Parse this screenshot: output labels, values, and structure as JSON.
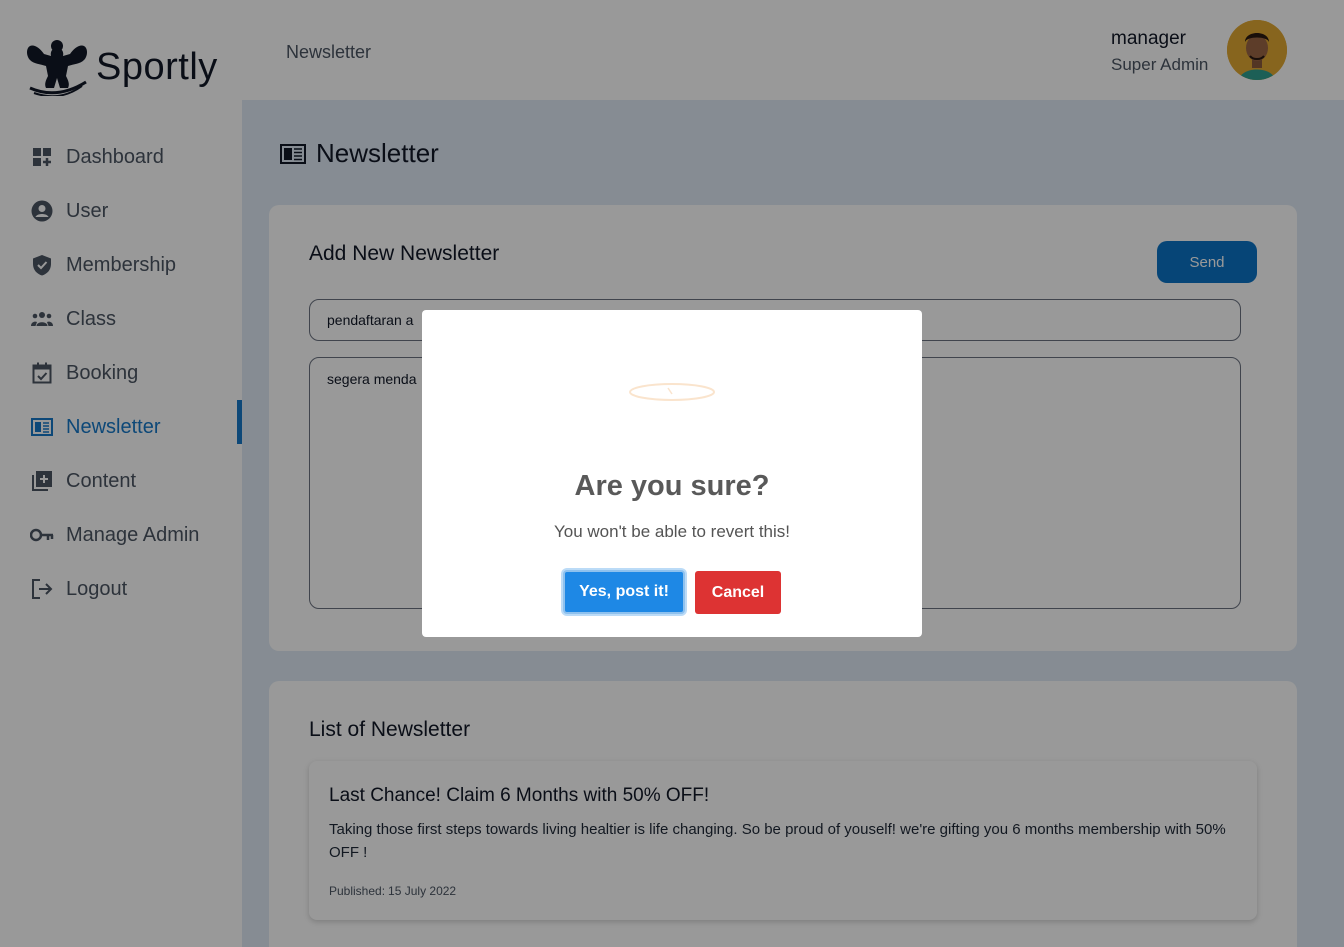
{
  "app": {
    "brand_name": "Sportly"
  },
  "sidebar": {
    "items": [
      {
        "label": "Dashboard",
        "icon": "dashboard-icon"
      },
      {
        "label": "User",
        "icon": "user-icon"
      },
      {
        "label": "Membership",
        "icon": "shield-icon"
      },
      {
        "label": "Class",
        "icon": "group-icon"
      },
      {
        "label": "Booking",
        "icon": "calendar-check-icon"
      },
      {
        "label": "Newsletter",
        "icon": "newspaper-icon",
        "active": true
      },
      {
        "label": "Content",
        "icon": "library-add-icon"
      },
      {
        "label": "Manage Admin",
        "icon": "key-icon"
      },
      {
        "label": "Logout",
        "icon": "logout-icon"
      }
    ]
  },
  "header": {
    "title": "Newsletter",
    "user": {
      "name": "manager",
      "role": "Super Admin"
    }
  },
  "main": {
    "page_title": "Newsletter",
    "add_form": {
      "title": "Add New Newsletter",
      "send_label": "Send",
      "title_value": "pendaftaran a",
      "body_value": "segera menda"
    },
    "list": {
      "title": "List of Newsletter",
      "items": [
        {
          "title": "Last Chance! Claim 6 Months with 50% OFF!",
          "body": "Taking those first steps towards living healtier is life changing. So be proud of youself! we're gifting you 6 months membership with 50% OFF !",
          "published_label": "Published:",
          "published_date": "15 July 2022"
        }
      ]
    }
  },
  "dialog": {
    "title": "Are you sure?",
    "text": "You won't be able to revert this!",
    "confirm_label": "Yes, post it!",
    "cancel_label": "Cancel",
    "colors": {
      "confirm": "#1e88e5",
      "cancel": "#dd3333"
    }
  },
  "colors": {
    "accent": "#1679c8",
    "send_button": "#0a73c7",
    "main_bg": "#dfe9f5"
  }
}
